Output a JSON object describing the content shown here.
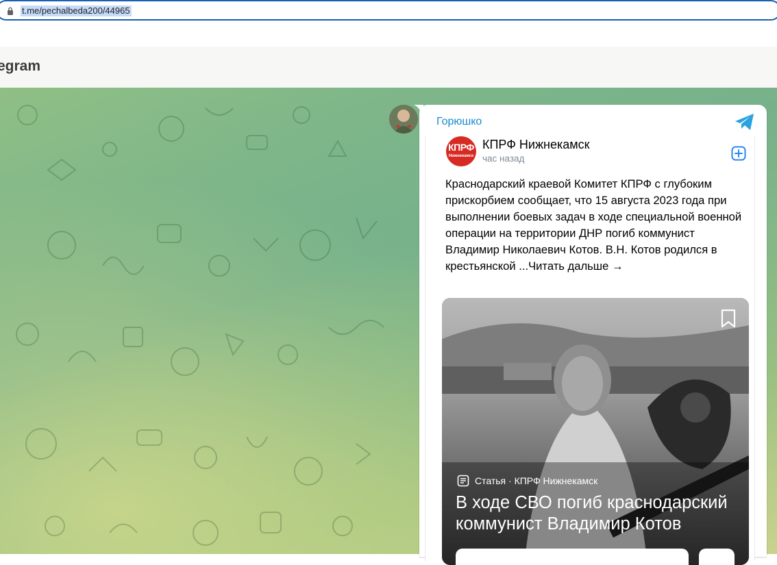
{
  "browser": {
    "url": "t.me/pechalbeda200/44965"
  },
  "header": {
    "title": "egram"
  },
  "message": {
    "sender_name": "Горюшко"
  },
  "vk_post": {
    "author": "КПРФ Нижнекамск",
    "logo_text_top": "КПРФ",
    "logo_text_bottom": "Нижнекамск",
    "time": "час назад",
    "text": "Краснодарский краевой Комитет КПРФ с глубоким прискорбием сообщает, что 15 августа 2023 года при выполнении боевых задач в ходе специальной военной операции на территории ДНР погиб коммунист Владимир Николаевич Котов. В.Н. Котов родился в крестьянской ...Читать дальше →"
  },
  "article": {
    "meta": "Статья · КПРФ Нижнекамск",
    "title": "В ходе СВО погиб краснодарский коммунист Владимир Котов"
  },
  "colors": {
    "accent": "#168acd",
    "vk_red": "#d72a22",
    "url_highlight": "#c6dbf7"
  }
}
